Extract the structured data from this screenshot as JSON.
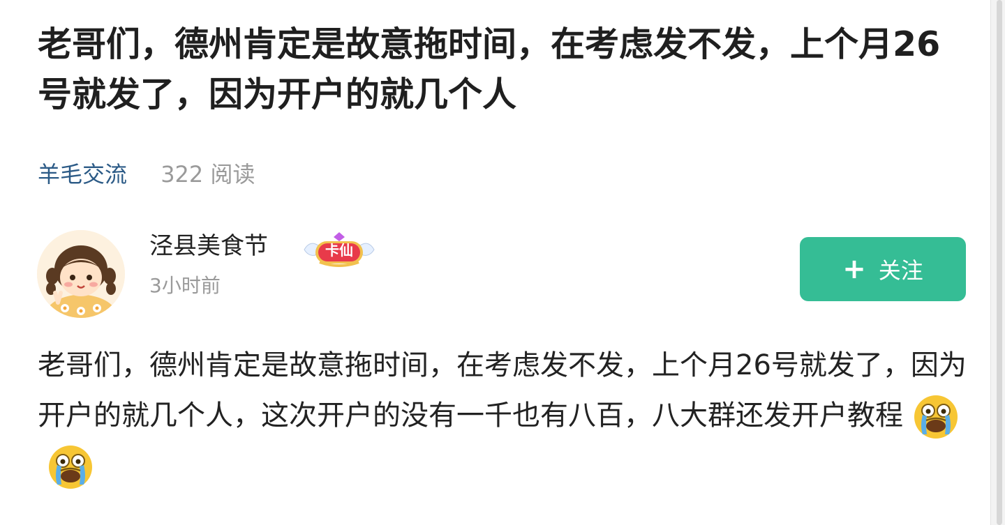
{
  "post": {
    "title": "老哥们，德州肯定是故意拖时间，在考虑发不发，上个月26号就发了，因为开户的就几个人",
    "category": "羊毛交流",
    "read_count": "322 阅读",
    "body": "老哥们，德州肯定是故意拖时间，在考虑发不发，上个月26号就发了，因为开户的就几个人，这次开户的没有一千也有八百，八大群还发开户教程",
    "body_emojis": [
      "crying-face-emoji",
      "crying-face-emoji"
    ]
  },
  "author": {
    "name": "泾县美食节",
    "badge_label": "卡仙",
    "time": "3小时前",
    "avatar_icon": "girl-avatar"
  },
  "follow_button": {
    "icon": "plus-icon",
    "plus_symbol": "+",
    "label": "关注"
  },
  "colors": {
    "accent_green": "#35bd95",
    "category_blue": "#2b5a86",
    "muted_gray": "#9a9a9a",
    "badge_red": "#e83a4a"
  }
}
